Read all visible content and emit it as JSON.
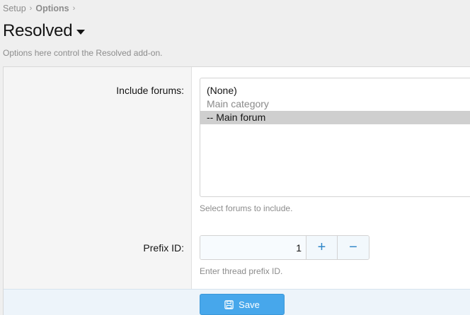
{
  "breadcrumb": {
    "items": [
      "Setup",
      "Options"
    ],
    "separator": "›"
  },
  "header": {
    "title": "Resolved",
    "description": "Options here control the Resolved add-on."
  },
  "fields": {
    "include_forums": {
      "label": "Include forums:",
      "options": [
        "(None)",
        "Main category",
        "-- Main forum"
      ],
      "selected": "-- Main forum",
      "hint": "Select forums to include."
    },
    "prefix_id": {
      "label": "Prefix ID:",
      "value": "1",
      "plus_label": "+",
      "minus_label": "−",
      "hint": "Enter thread prefix ID."
    }
  },
  "actions": {
    "save_label": "Save",
    "save_icon": "floppy-disk-icon"
  },
  "colors": {
    "accent": "#47a7eb",
    "stepper_glyph": "#2e86c8",
    "footer_bg": "#edf4fa"
  }
}
